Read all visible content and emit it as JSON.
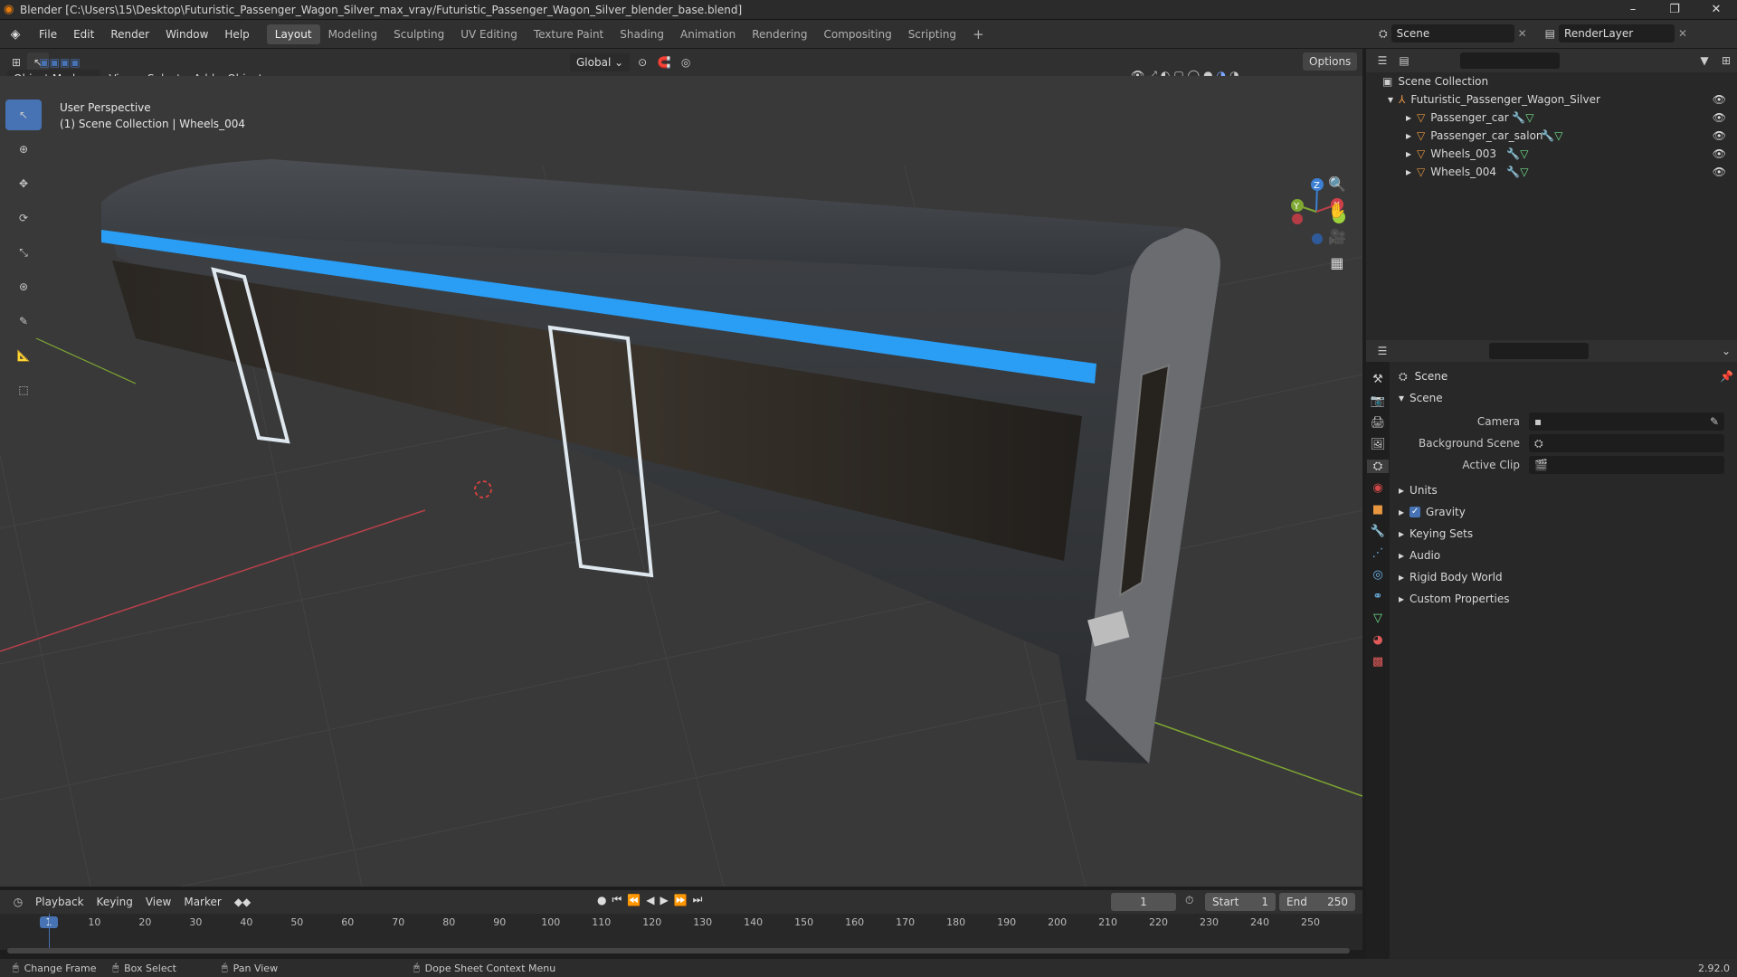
{
  "window": {
    "title": "Blender [C:\\Users\\15\\Desktop\\Futuristic_Passenger_Wagon_Silver_max_vray/Futuristic_Passenger_Wagon_Silver_blender_base.blend]",
    "minimize": "–",
    "maximize": "❐",
    "close": "✕"
  },
  "menu": [
    "File",
    "Edit",
    "Render",
    "Window",
    "Help"
  ],
  "workspaces": [
    "Layout",
    "Modeling",
    "Sculpting",
    "UV Editing",
    "Texture Paint",
    "Shading",
    "Animation",
    "Rendering",
    "Compositing",
    "Scripting"
  ],
  "scene_name": "Scene",
  "render_layer": "RenderLayer",
  "viewport_header": {
    "mode": "Object Mode",
    "menus": [
      "View",
      "Select",
      "Add",
      "Object"
    ],
    "orientation": "Global",
    "options": "Options"
  },
  "viewport_overlay": {
    "line1": "User Perspective",
    "line2": "(1) Scene Collection | Wheels_004"
  },
  "gizmo": {
    "x": "X",
    "y": "Y",
    "z": "Z"
  },
  "outliner": {
    "root": "Scene Collection",
    "collection": "Futuristic_Passenger_Wagon_Silver",
    "objects": [
      "Passenger_car",
      "Passenger_car_salon",
      "Wheels_003",
      "Wheels_004"
    ]
  },
  "properties": {
    "header": "Scene",
    "panel": "Scene",
    "camera_label": "Camera",
    "background_label": "Background Scene",
    "clip_label": "Active Clip",
    "sections": [
      "Units",
      "Gravity",
      "Keying Sets",
      "Audio",
      "Rigid Body World",
      "Custom Properties"
    ],
    "gravity_checked": true
  },
  "timeline": {
    "menus": [
      "Playback",
      "Keying",
      "View",
      "Marker"
    ],
    "current_frame": "1",
    "start_label": "Start",
    "start": "1",
    "end_label": "End",
    "end": "250",
    "ticks": [
      "1",
      "10",
      "20",
      "30",
      "40",
      "50",
      "60",
      "70",
      "80",
      "90",
      "100",
      "110",
      "120",
      "130",
      "140",
      "150",
      "160",
      "170",
      "180",
      "190",
      "200",
      "210",
      "220",
      "230",
      "240",
      "250"
    ]
  },
  "status": {
    "change_frame": "Change Frame",
    "box_select": "Box Select",
    "pan_view": "Pan View",
    "context_menu": "Dope Sheet Context Menu",
    "version": "2.92.0"
  },
  "colors": {
    "accent": "#4772b3",
    "stripe": "#2a9df4",
    "door_outline": "#dfe8ee",
    "x_axis": "#b8404a",
    "y_axis": "#7fa832",
    "z_axis": "#3c7fd4"
  }
}
